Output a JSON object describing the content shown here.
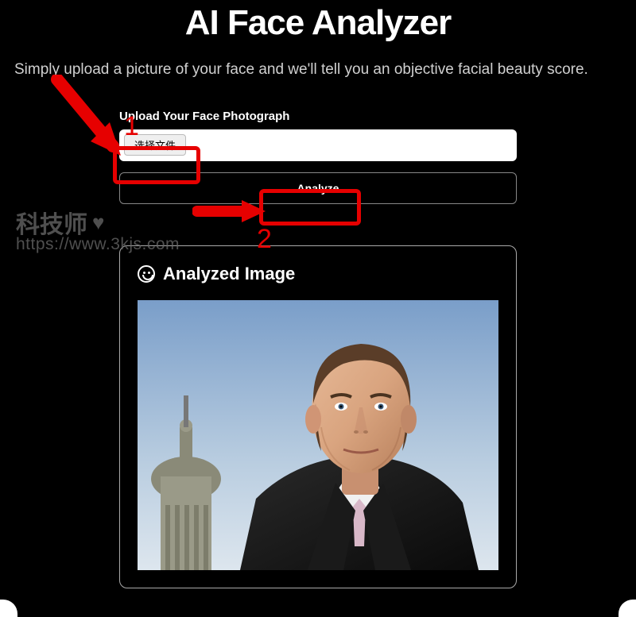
{
  "header": {
    "title": "AI Face Analyzer",
    "subtitle": "Simply upload a picture of your face and we'll tell you an objective facial beauty score."
  },
  "form": {
    "upload_label": "Upload Your Face Photograph",
    "file_button_label": "选择文件",
    "analyze_label": "Analyze"
  },
  "result": {
    "title": "Analyzed Image"
  },
  "annotations": {
    "step1": "1",
    "step2": "2"
  },
  "watermark": {
    "name": "科技师",
    "url": "https://www.3kjs.com"
  },
  "colors": {
    "annotation": "#e60000",
    "background": "#000000",
    "text": "#ffffff"
  }
}
